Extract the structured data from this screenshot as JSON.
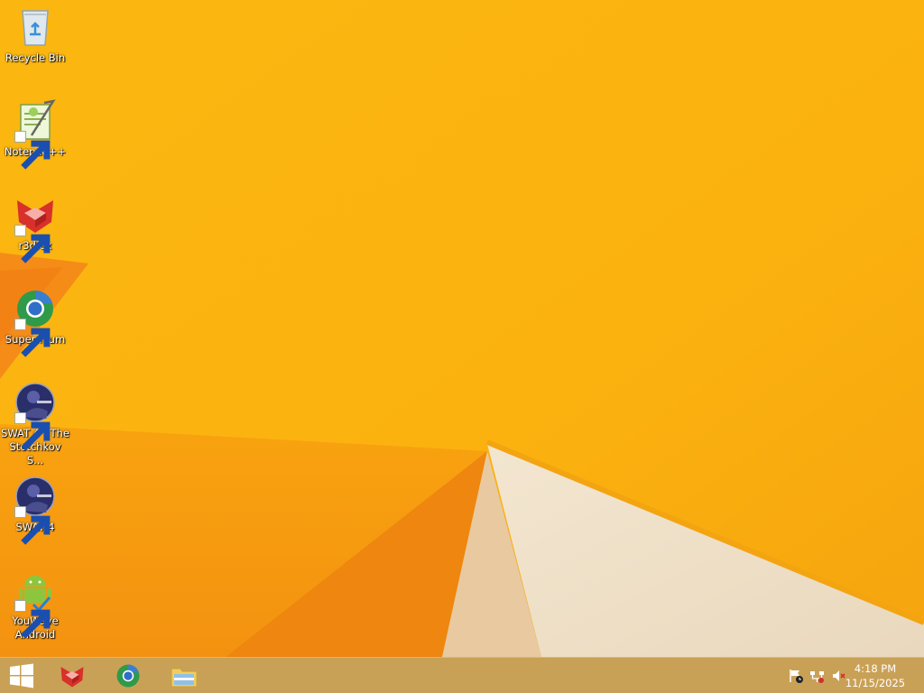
{
  "desktop": {
    "icons": [
      {
        "label": "Recycle Bin"
      },
      {
        "label": "Notepad++"
      },
      {
        "label": "r3dfox"
      },
      {
        "label": "Supermium"
      },
      {
        "label": "SWAT 4 - The Stetchkov S..."
      },
      {
        "label": "SWAT 4"
      },
      {
        "label": "YouWave Android"
      }
    ]
  },
  "taskbar": {
    "start_icon": "windows-logo-icon",
    "pinned": [
      "r3dfox-icon",
      "supermium-icon",
      "file-explorer-icon"
    ],
    "tray": [
      "action-center-flag-icon",
      "network-icon",
      "volume-muted-icon"
    ],
    "clock": {
      "time": "4:18 PM",
      "date": "11/15/2025"
    }
  },
  "colors": {
    "accent": "#f8b418",
    "taskbar": "#c4a05c"
  }
}
